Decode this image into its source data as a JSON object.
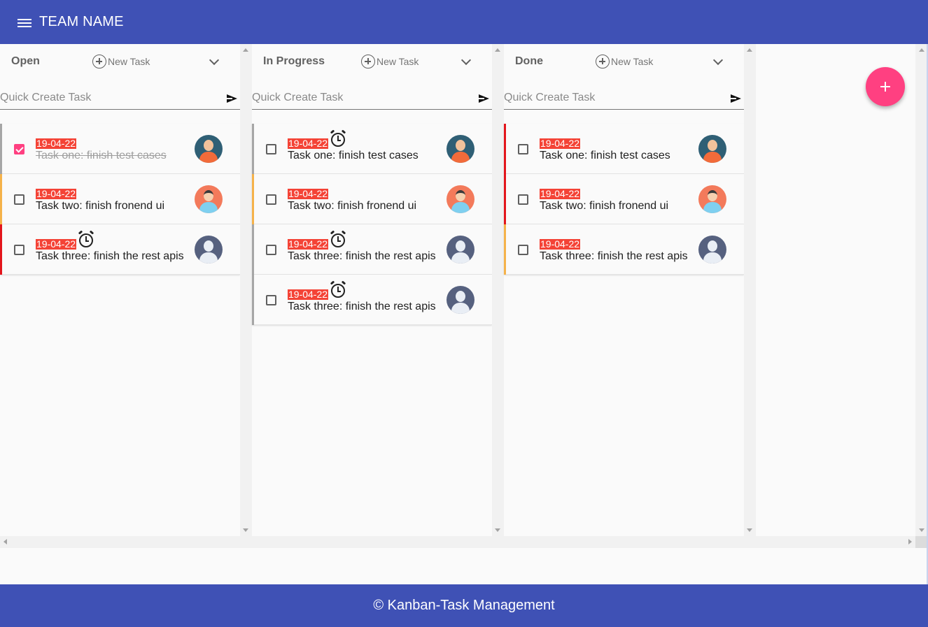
{
  "app": {
    "team_name": "TEAM NAME",
    "footer": "© Kanban-Task Management"
  },
  "quick_create_placeholder": "Quick Create Task",
  "new_task_label": "New Task",
  "colors": {
    "primary": "#3f51b5",
    "accent": "#ff4081",
    "date_badge": "#f44336",
    "stripe_grey": "#a6a6a6",
    "stripe_amber": "#f5b24a",
    "stripe_red": "#e3151c"
  },
  "columns": [
    {
      "title": "Open",
      "tasks": [
        {
          "date": "19-04-22",
          "title": "Task one: finish test cases",
          "checked": true,
          "alarm": false,
          "stripe": "#a6a6a6",
          "avatar": "a1"
        },
        {
          "date": "19-04-22",
          "title": "Task two: finish fronend ui",
          "checked": false,
          "alarm": false,
          "stripe": "#f5b24a",
          "avatar": "a2"
        },
        {
          "date": "19-04-22",
          "title": "Task three: finish the rest apis",
          "checked": false,
          "alarm": true,
          "stripe": "#e3151c",
          "avatar": "a3"
        }
      ]
    },
    {
      "title": "In Progress",
      "tasks": [
        {
          "date": "19-04-22",
          "title": "Task one: finish test cases",
          "checked": false,
          "alarm": true,
          "stripe": "#a6a6a6",
          "avatar": "a1"
        },
        {
          "date": "19-04-22",
          "title": "Task two: finish fronend ui",
          "checked": false,
          "alarm": false,
          "stripe": "#f5b24a",
          "avatar": "a2"
        },
        {
          "date": "19-04-22",
          "title": "Task three: finish the rest apis",
          "checked": false,
          "alarm": true,
          "stripe": "#a6a6a6",
          "avatar": "a3"
        },
        {
          "date": "19-04-22",
          "title": "Task three: finish the rest apis",
          "checked": false,
          "alarm": true,
          "stripe": "#a6a6a6",
          "avatar": "a3"
        }
      ]
    },
    {
      "title": "Done",
      "tasks": [
        {
          "date": "19-04-22",
          "title": "Task one: finish test cases",
          "checked": false,
          "alarm": false,
          "stripe": "#e3151c",
          "avatar": "a1"
        },
        {
          "date": "19-04-22",
          "title": "Task two: finish fronend ui",
          "checked": false,
          "alarm": false,
          "stripe": "#e3151c",
          "avatar": "a2"
        },
        {
          "date": "19-04-22",
          "title": "Task three: finish the rest apis",
          "checked": false,
          "alarm": false,
          "stripe": "#f5b24a",
          "avatar": "a3"
        }
      ]
    }
  ]
}
